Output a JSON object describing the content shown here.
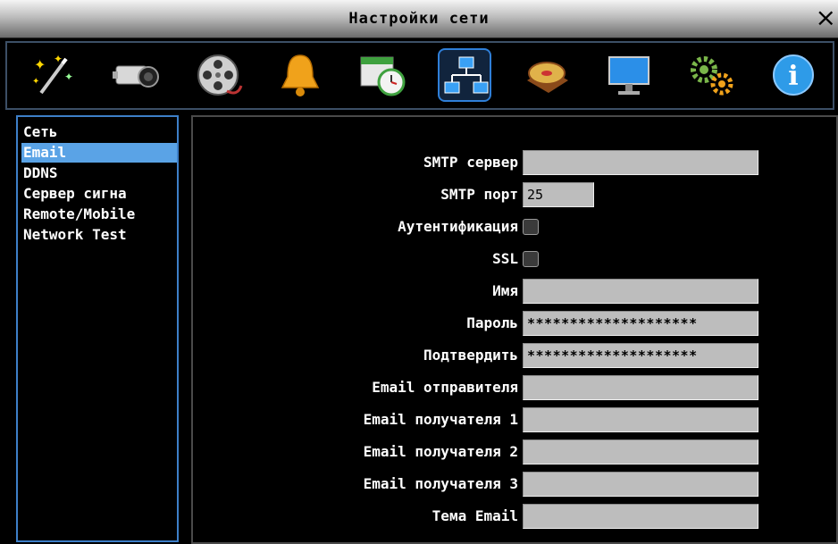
{
  "window": {
    "title": "Настройки сети",
    "close_label": "×"
  },
  "toolbar": {
    "icons": [
      {
        "name": "magic-wand-icon"
      },
      {
        "name": "camera-icon"
      },
      {
        "name": "film-reel-icon"
      },
      {
        "name": "bell-icon"
      },
      {
        "name": "schedule-clock-icon"
      },
      {
        "name": "network-icon",
        "active": true
      },
      {
        "name": "hard-disk-icon"
      },
      {
        "name": "monitor-icon"
      },
      {
        "name": "gears-icon"
      },
      {
        "name": "info-icon"
      }
    ]
  },
  "sidebar": {
    "items": [
      {
        "label": "Сеть"
      },
      {
        "label": "Email",
        "selected": true
      },
      {
        "label": "DDNS"
      },
      {
        "label": "Сервер сигна"
      },
      {
        "label": "Remote/Mobile"
      },
      {
        "label": "Network Test"
      }
    ]
  },
  "form": {
    "smtp_server": {
      "label": "SMTP сервер",
      "value": ""
    },
    "smtp_port": {
      "label": "SMTP порт",
      "value": "25"
    },
    "authentication": {
      "label": "Аутентификация",
      "checked": false
    },
    "ssl": {
      "label": "SSL",
      "checked": false
    },
    "username": {
      "label": "Имя",
      "value": ""
    },
    "password": {
      "label": "Пароль",
      "value": "********************"
    },
    "confirm": {
      "label": "Подтвердить",
      "value": "********************"
    },
    "sender": {
      "label": "Email отправителя",
      "value": ""
    },
    "recipient1": {
      "label": "Email получателя 1",
      "value": ""
    },
    "recipient2": {
      "label": "Email получателя 2",
      "value": ""
    },
    "recipient3": {
      "label": "Email получателя 3",
      "value": ""
    },
    "subject": {
      "label": "Тема Email",
      "value": ""
    }
  },
  "colors": {
    "selection": "#5aa3e6",
    "sidebar_border": "#3d7fc8",
    "field_bg": "#bdbdbd"
  }
}
